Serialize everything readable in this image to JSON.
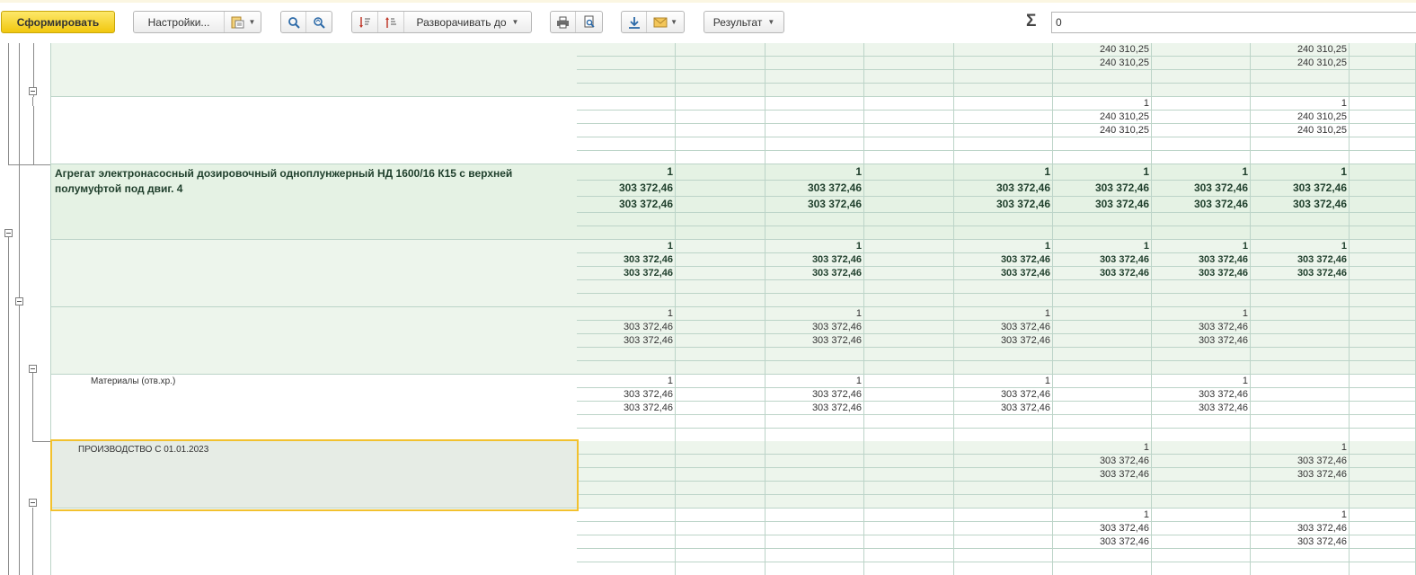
{
  "toolbar": {
    "generate_label": "Сформировать",
    "settings_label": "Настройки...",
    "expand_label": "Разворачивать до",
    "result_label": "Результат",
    "sum_symbol": "Σ",
    "sum_value": "0"
  },
  "icons": {
    "settings_variant": "report-variant-icon",
    "search": "search-icon",
    "search_next": "search-next-icon",
    "sort_desc": "sort-descending-icon",
    "sort_asc": "sort-ascending-icon",
    "print": "print-icon",
    "preview": "print-preview-icon",
    "save": "save-download-icon",
    "mail": "mail-icon"
  },
  "colors": {
    "primary_button": "#f1c70e",
    "group_band": "#e5f2e4",
    "selected_border": "#f2c12e",
    "grid_line": "#bcd4c8"
  },
  "report": {
    "blocks": [
      {
        "id": "top-group",
        "label": "",
        "rows": [
          [
            "",
            "",
            "",
            "",
            "",
            "240 310,25",
            "",
            "240 310,25"
          ],
          [
            "",
            "",
            "",
            "",
            "",
            "240 310,25",
            "",
            "240 310,25"
          ],
          [
            "",
            "",
            "",
            "",
            "",
            "",
            "",
            ""
          ],
          [
            "",
            "",
            "",
            "",
            "",
            "",
            "",
            ""
          ]
        ]
      },
      {
        "id": "top-detail",
        "label": "",
        "rows": [
          [
            "",
            "",
            "",
            "",
            "",
            "1",
            "",
            "1"
          ],
          [
            "",
            "",
            "",
            "",
            "",
            "240 310,25",
            "",
            "240 310,25"
          ],
          [
            "",
            "",
            "",
            "",
            "",
            "240 310,25",
            "",
            "240 310,25"
          ],
          [
            "",
            "",
            "",
            "",
            "",
            "",
            "",
            ""
          ],
          [
            "",
            "",
            "",
            "",
            "",
            "",
            "",
            ""
          ]
        ]
      },
      {
        "id": "product",
        "label": "Агрегат электронасосный дозировочный одноплунжерный НД 1600/16 К15  с верхней полумуфтой под двиг. 4",
        "rows": [
          [
            "1",
            "",
            "1",
            "",
            "1",
            "1",
            "1",
            "1"
          ],
          [
            "303 372,46",
            "",
            "303 372,46",
            "",
            "303 372,46",
            "303 372,46",
            "303 372,46",
            "303 372,46"
          ],
          [
            "303 372,46",
            "",
            "303 372,46",
            "",
            "303 372,46",
            "303 372,46",
            "303 372,46",
            "303 372,46"
          ],
          [
            "",
            "",
            "",
            "",
            "",
            "",
            "",
            ""
          ],
          [
            "",
            "",
            "",
            "",
            "",
            "",
            "",
            ""
          ]
        ]
      },
      {
        "id": "sub-total",
        "label": "",
        "rows": [
          [
            "1",
            "",
            "1",
            "",
            "1",
            "1",
            "1",
            "1"
          ],
          [
            "303 372,46",
            "",
            "303 372,46",
            "",
            "303 372,46",
            "303 372,46",
            "303 372,46",
            "303 372,46"
          ],
          [
            "303 372,46",
            "",
            "303 372,46",
            "",
            "303 372,46",
            "303 372,46",
            "303 372,46",
            "303 372,46"
          ],
          [
            "",
            "",
            "",
            "",
            "",
            "",
            "",
            ""
          ],
          [
            "",
            "",
            "",
            "",
            "",
            "",
            "",
            ""
          ]
        ]
      },
      {
        "id": "sub-group",
        "label": "",
        "rows": [
          [
            "1",
            "",
            "1",
            "",
            "1",
            "",
            "1",
            ""
          ],
          [
            "303 372,46",
            "",
            "303 372,46",
            "",
            "303 372,46",
            "",
            "303 372,46",
            ""
          ],
          [
            "303 372,46",
            "",
            "303 372,46",
            "",
            "303 372,46",
            "",
            "303 372,46",
            ""
          ],
          [
            "",
            "",
            "",
            "",
            "",
            "",
            "",
            ""
          ],
          [
            "",
            "",
            "",
            "",
            "",
            "",
            "",
            ""
          ]
        ]
      },
      {
        "id": "materials",
        "label": "Материалы (отв.хр.)",
        "rows": [
          [
            "1",
            "",
            "1",
            "",
            "1",
            "",
            "1",
            ""
          ],
          [
            "303 372,46",
            "",
            "303 372,46",
            "",
            "303 372,46",
            "",
            "303 372,46",
            ""
          ],
          [
            "303 372,46",
            "",
            "303 372,46",
            "",
            "303 372,46",
            "",
            "303 372,46",
            ""
          ],
          [
            "",
            "",
            "",
            "",
            "",
            "",
            "",
            ""
          ],
          [
            "",
            "",
            "",
            "",
            "",
            "",
            "",
            ""
          ]
        ]
      },
      {
        "id": "production",
        "label": "ПРОИЗВОДСТВО С 01.01.2023",
        "rows": [
          [
            "",
            "",
            "",
            "",
            "",
            "1",
            "",
            "1"
          ],
          [
            "",
            "",
            "",
            "",
            "",
            "303 372,46",
            "",
            "303 372,46"
          ],
          [
            "",
            "",
            "",
            "",
            "",
            "303 372,46",
            "",
            "303 372,46"
          ],
          [
            "",
            "",
            "",
            "",
            "",
            "",
            "",
            ""
          ],
          [
            "",
            "",
            "",
            "",
            "",
            "",
            "",
            ""
          ]
        ]
      },
      {
        "id": "bottom-detail",
        "label": "",
        "rows": [
          [
            "",
            "",
            "",
            "",
            "",
            "1",
            "",
            "1"
          ],
          [
            "",
            "",
            "",
            "",
            "",
            "303 372,46",
            "",
            "303 372,46"
          ],
          [
            "",
            "",
            "",
            "",
            "",
            "303 372,46",
            "",
            "303 372,46"
          ],
          [
            "",
            "",
            "",
            "",
            "",
            "",
            "",
            ""
          ],
          [
            "",
            "",
            "",
            "",
            "",
            "",
            "",
            ""
          ]
        ]
      }
    ]
  }
}
